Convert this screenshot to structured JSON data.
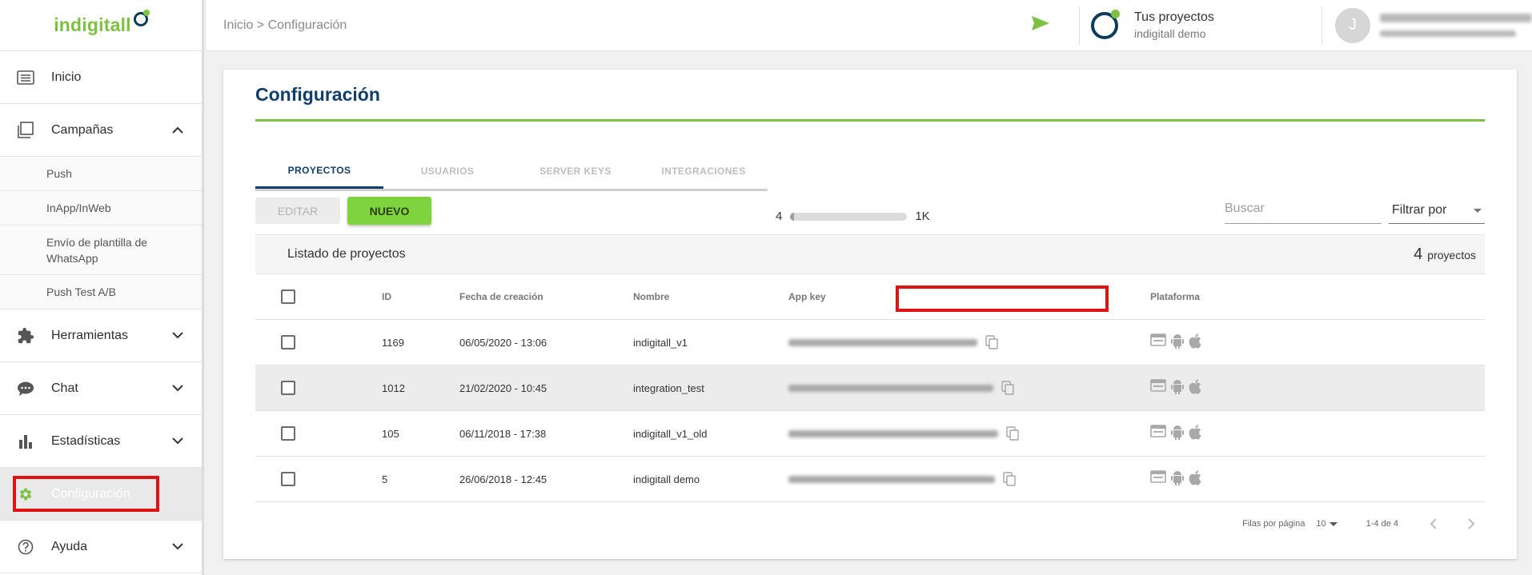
{
  "brand": {
    "name": "indigitall",
    "accent_color": "#7cc142",
    "navy_color": "#123e6b"
  },
  "sidebar": {
    "items": [
      {
        "label": "Inicio",
        "icon": "home-list-icon"
      },
      {
        "label": "Campañas",
        "icon": "campaigns-icon",
        "expanded": true,
        "subitems": [
          "Push",
          "InApp/InWeb",
          "Envío de plantilla de WhatsApp",
          "Push Test A/B"
        ]
      },
      {
        "label": "Herramientas",
        "icon": "puzzle-icon"
      },
      {
        "label": "Chat",
        "icon": "chat-icon"
      },
      {
        "label": "Estadísticas",
        "icon": "bar-chart-icon"
      },
      {
        "label": "Configuración",
        "icon": "gear-icon",
        "active": true
      },
      {
        "label": "Ayuda",
        "icon": "help-icon"
      }
    ]
  },
  "header": {
    "breadcrumb": "Inicio > Configuración",
    "project_switcher": {
      "title": "Tus proyectos",
      "subtitle": "indigitall demo"
    },
    "user": {
      "initial": "J"
    }
  },
  "main": {
    "title": "Configuración",
    "tabs": [
      {
        "label": "PROYECTOS",
        "active": true
      },
      {
        "label": "USUARIOS"
      },
      {
        "label": "SERVER KEYS"
      },
      {
        "label": "INTEGRACIONES"
      }
    ],
    "buttons": {
      "edit": "EDITAR",
      "new": "NUEVO"
    },
    "usage": {
      "current": "4",
      "max": "1K",
      "fill_fraction": 0.004
    },
    "search": {
      "placeholder": "Buscar",
      "value": ""
    },
    "filter": {
      "label": "Filtrar por"
    },
    "list": {
      "title": "Listado de proyectos",
      "count": "4",
      "count_label": "proyectos"
    },
    "table": {
      "columns": [
        "ID",
        "Fecha de creación",
        "Nombre",
        "App key",
        "Plataforma"
      ],
      "rows": [
        {
          "id": "1169",
          "date": "06/05/2020 - 13:06",
          "name": "indigitall_v1"
        },
        {
          "id": "1012",
          "date": "21/02/2020 - 10:45",
          "name": "integration_test"
        },
        {
          "id": "105",
          "date": "06/11/2018 - 17:38",
          "name": "indigitall_v1_old"
        },
        {
          "id": "5",
          "date": "26/06/2018 - 12:45",
          "name": "indigitall demo"
        }
      ],
      "platform_icons": [
        "web-browser-icon",
        "android-icon",
        "apple-icon"
      ]
    },
    "pagination": {
      "rows_per_page_label": "Filas por página",
      "rows_per_page": "10",
      "range": "1-4 de 4"
    }
  }
}
